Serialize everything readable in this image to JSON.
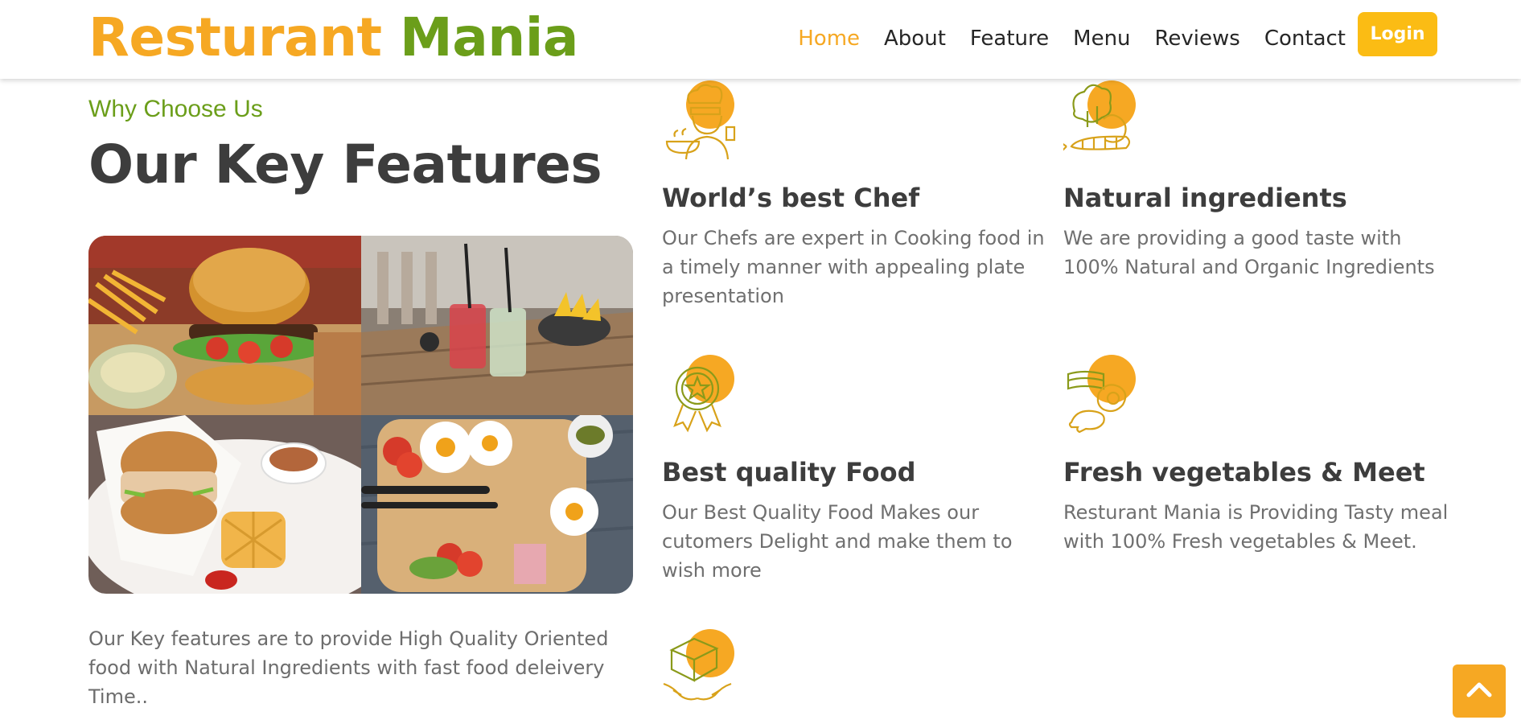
{
  "brand": {
    "part1": "Resturant",
    "part2": "Mania"
  },
  "nav": {
    "items": [
      "Home",
      "About",
      "Feature",
      "Menu",
      "Reviews",
      "Contact"
    ],
    "active": "Home",
    "login_label": "Login"
  },
  "section": {
    "eyebrow": "Why Choose Us",
    "title": "Our Key Features",
    "intro": "Our Key features are to provide High Quality Oriented food with Natural Ingredients with fast food deleivery Time.."
  },
  "features": [
    {
      "icon": "chef-icon",
      "title": "World’s best Chef",
      "text": "Our Chefs are expert in Cooking food in a timely manner with appealing plate presentation"
    },
    {
      "icon": "vegetables-icon",
      "title": "Natural ingredients",
      "text": "We are providing a good taste with 100% Natural and Organic Ingredients"
    },
    {
      "icon": "award-badge-icon",
      "title": "Best quality Food",
      "text": "Our Best Quality Food Makes our cutomers Delight and make them to wish more"
    },
    {
      "icon": "meat-icon",
      "title": "Fresh vegetables & Meet",
      "text": "Resturant Mania is Providing Tasty meal with 100% Fresh vegetables & Meet."
    },
    {
      "icon": "delivery-box-icon",
      "title": "",
      "text": ""
    }
  ],
  "colors": {
    "orange": "#f6a823",
    "green": "#6b9e1a",
    "login_yellow": "#fbbc14",
    "icon_gold": "#d8a21a"
  },
  "scroll_top_icon": "chevron-up-icon"
}
